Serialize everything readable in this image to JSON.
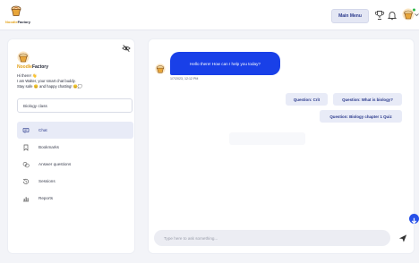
{
  "app": {
    "brand_prefix": "Noodle",
    "brand_suffix": "Factory"
  },
  "header": {
    "menu_label": "Main Menu",
    "icons": [
      "trophy-icon",
      "bell-icon",
      "user-avatar-icon",
      "chevron-down-icon"
    ]
  },
  "sidebar": {
    "greeting": [
      "Hi there! 👋",
      "I am Walter, your smart chat buddy.",
      "Stay safe 😊 and happy chatting! 😊💭"
    ],
    "class_selector": "Biology class",
    "nav": [
      {
        "label": "Chat",
        "icon": "chat-icon",
        "active": true
      },
      {
        "label": "Bookmarks",
        "icon": "bookmark-icon",
        "active": false
      },
      {
        "label": "Answer questions",
        "icon": "answer-icon",
        "active": false
      },
      {
        "label": "Sessions",
        "icon": "history-icon",
        "active": false
      },
      {
        "label": "Reports",
        "icon": "chart-icon",
        "active": false
      }
    ]
  },
  "chat": {
    "bot_message": "Hello there! How can I help you today?",
    "timestamp": "1/7/2023, 12:12 PM",
    "suggestions": [
      "Question: Crit",
      "Question: What is biology?",
      "Question: Biology chapter 1 Quiz"
    ],
    "input_placeholder": "Type here to ask something..."
  },
  "colors": {
    "accent": "#1940e8",
    "chip_bg": "#e8ebf7",
    "chip_text": "#2b3a8c",
    "brand_yellow": "#e3a21a"
  }
}
